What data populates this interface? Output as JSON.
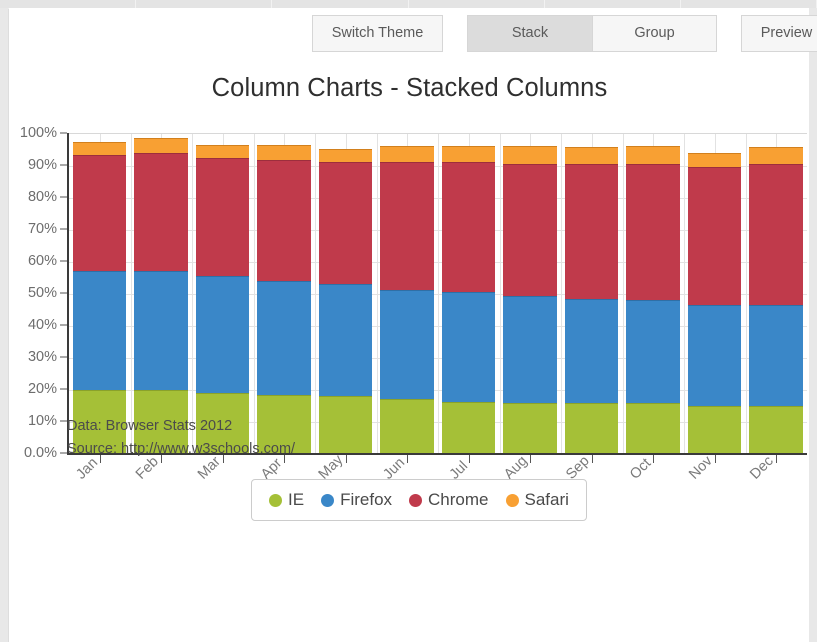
{
  "toolbar": {
    "switch_theme_label": "Switch Theme",
    "stack_label": "Stack",
    "group_label": "Group",
    "preview_label": "Preview"
  },
  "header": {
    "title": "Column Charts - Stacked Columns"
  },
  "footer": {
    "data_line": "Data: Browser Stats 2012",
    "source_line": "Source: http://www.w3schools.com/"
  },
  "legend": {
    "items": [
      {
        "label": "IE",
        "color": "#a5c037"
      },
      {
        "label": "Firefox",
        "color": "#3a87c8"
      },
      {
        "label": "Chrome",
        "color": "#c03a4b"
      },
      {
        "label": "Safari",
        "color": "#f8a033"
      }
    ]
  },
  "axis": {
    "y_ticks": [
      "100%",
      "90%",
      "80%",
      "70%",
      "60%",
      "50%",
      "40%",
      "30%",
      "20%",
      "10%",
      "0.0%"
    ]
  },
  "chart_data": {
    "type": "bar",
    "subtype": "stacked-column",
    "title": "Column Charts - Stacked Columns",
    "xlabel": "",
    "ylabel": "",
    "ylim": [
      0,
      100
    ],
    "ytick_labels": [
      "0.0%",
      "10%",
      "20%",
      "30%",
      "40%",
      "50%",
      "60%",
      "70%",
      "80%",
      "90%",
      "100%"
    ],
    "grid": true,
    "legend_position": "bottom",
    "categories": [
      "Jan",
      "Feb",
      "Mar",
      "Apr",
      "May",
      "Jun",
      "Jul",
      "Aug",
      "Sep",
      "Oct",
      "Nov",
      "Dec"
    ],
    "series": [
      {
        "name": "IE",
        "color": "#a5c037",
        "values": [
          19.8,
          19.7,
          18.8,
          18.0,
          17.9,
          16.8,
          15.9,
          15.7,
          15.6,
          15.6,
          14.8,
          14.6
        ]
      },
      {
        "name": "Firefox",
        "color": "#3a87c8",
        "values": [
          37.1,
          37.1,
          36.5,
          35.9,
          35.0,
          34.3,
          34.3,
          33.4,
          32.4,
          32.3,
          31.5,
          31.7
        ]
      },
      {
        "name": "Chrome",
        "color": "#c03a4b",
        "values": [
          36.3,
          36.9,
          37.0,
          37.6,
          38.0,
          39.7,
          40.6,
          41.3,
          42.2,
          42.3,
          43.2,
          44.0
        ]
      },
      {
        "name": "Safari",
        "color": "#f8a033",
        "values": [
          4.0,
          4.9,
          4.0,
          4.8,
          4.1,
          5.2,
          5.1,
          5.5,
          5.4,
          5.6,
          4.3,
          5.2
        ]
      }
    ],
    "totals": [
      97.2,
      98.6,
      96.3,
      96.3,
      95.0,
      96.0,
      95.9,
      95.9,
      95.6,
      95.8,
      93.8,
      95.5
    ]
  }
}
